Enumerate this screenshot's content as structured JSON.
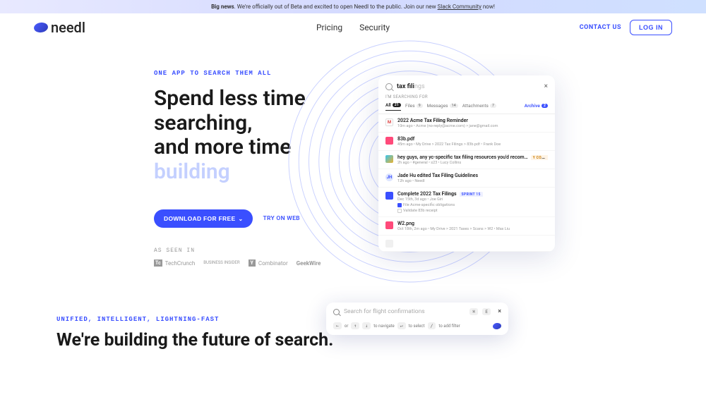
{
  "banner": {
    "bold": "Big news",
    "text": ". We're officially out of Beta and excited to open Needl to the public. Join our new ",
    "link": "Slack Community",
    "suffix": " now!"
  },
  "brand": "needl",
  "nav": {
    "pricing": "Pricing",
    "security": "Security"
  },
  "header": {
    "contact": "CONTACT US",
    "login": "LOG IN"
  },
  "hero": {
    "eyebrow": "ONE APP TO SEARCH THEM ALL",
    "line1": "Spend less time",
    "line2": "searching,",
    "line3": "and more time",
    "line4": "building",
    "cta_primary": "DOWNLOAD FOR FREE",
    "cta_secondary": "TRY ON WEB",
    "seen_label": "AS SEEN IN",
    "seen": [
      "TechCrunch",
      "BUSINESS INSIDER",
      "Combinator",
      "GeekWire"
    ]
  },
  "mockup": {
    "query_typed": "tax fili",
    "query_ghost": "ngs",
    "searching_for": "I'M SEARCHING FOR",
    "tabs": [
      {
        "label": "All",
        "count": "21",
        "active": true
      },
      {
        "label": "Files",
        "count": "9"
      },
      {
        "label": "Messages",
        "count": "14"
      },
      {
        "label": "Attachments",
        "count": "7"
      }
    ],
    "archive": "Archive",
    "archive_count": "2",
    "results": [
      {
        "icon": "gmail",
        "icon_text": "M",
        "title_pre": "2022 Acme ",
        "title_hl": "Tax Filing",
        "title_post": " Reminder",
        "meta": "10m ago • Acme (no-reply@acme.com) > jane@gmail.com"
      },
      {
        "icon": "pdf",
        "icon_text": "",
        "title_pre": "83b.pdf",
        "title_hl": "",
        "title_post": "",
        "meta": "45m ago • My Drive > 2022 Tax Filings > 83b.pdf • Frank Doe"
      },
      {
        "icon": "slack",
        "icon_text": "",
        "title_pre": "hey guys, any yc-specific tax filing resources you'd recom…",
        "title_hl": "",
        "title_post": "",
        "meta": "2h ago • #general • s23 • Lucy Collins",
        "right_tag": "Y COMBINATOR"
      },
      {
        "icon": "avatar",
        "icon_text": "JH",
        "title_pre": "Jade Hu edited ",
        "title_hl": "Tax Filing",
        "title_post": " Guidelines",
        "meta": "12h ago • Needl"
      },
      {
        "icon": "doc",
        "icon_text": "",
        "title_pre": "Complete 2022 ",
        "title_hl": "Tax Filings",
        "title_post": "",
        "meta": "Dec 15th, 3d ago • Joe Giri",
        "right_tag": "SPRINT 15",
        "extras": [
          {
            "done": true,
            "text": "File Acme-specific obligations"
          },
          {
            "done": false,
            "text": "Validate 83b receipt"
          }
        ]
      },
      {
        "icon": "png",
        "icon_text": "",
        "title_pre": "W2.png",
        "title_hl": "",
        "title_post": "",
        "meta": "Oct 18th, 2m ago • My Drive > 2021 Taxes > Scans > W2 • Max Liu"
      },
      {
        "icon": "placeholder",
        "icon_text": "",
        "title_pre": "",
        "title_hl": "",
        "title_post": "",
        "meta": ""
      }
    ]
  },
  "cmdbar": {
    "placeholder": "Search for flight confirmations",
    "kbd1": "⌘",
    "kbd2": "E",
    "hint_or": "or",
    "hint_nav": "to navigate",
    "hint_sel": "to select",
    "hint_filter": "to add filter",
    "k_left": "←",
    "k_up": "↑",
    "k_down": "↓",
    "k_enter": "↵",
    "k_slash": "/"
  },
  "section2": {
    "eyebrow": "UNIFIED, INTELLIGENT, LIGHTNING-FAST",
    "headline": "We're building the future of search."
  }
}
